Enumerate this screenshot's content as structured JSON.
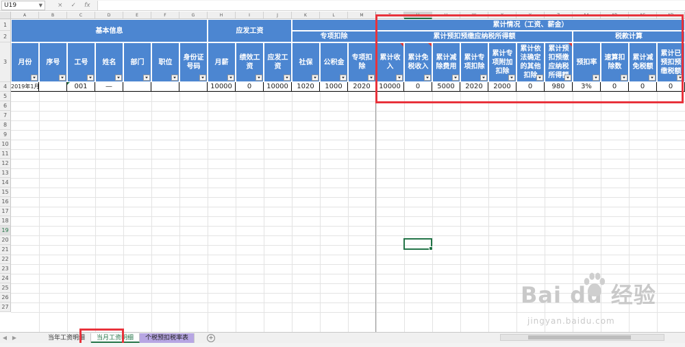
{
  "formula_bar": {
    "name_box": "U19",
    "cancel_icon": "×",
    "enter_icon": "✓",
    "fx_icon": "fx"
  },
  "columns": [
    "A",
    "B",
    "C",
    "D",
    "E",
    "F",
    "G",
    "H",
    "I",
    "J",
    "K",
    "L",
    "M",
    "T",
    "U",
    "V",
    "W",
    "X",
    "Y",
    "Z",
    "AA",
    "AB",
    "AC",
    "AD"
  ],
  "rows": [
    "1",
    "2",
    "3",
    "4",
    "5",
    "6",
    "7",
    "8",
    "9",
    "10",
    "11",
    "12",
    "13",
    "14",
    "15",
    "16",
    "17",
    "18",
    "19",
    "20",
    "21",
    "22",
    "23",
    "24",
    "25",
    "26",
    "27"
  ],
  "groups": {
    "basic_info": "基本信息",
    "gross_wage": "应发工资",
    "special_deduction": "专项扣除",
    "cumulative": "累计情况（工资、薪金）",
    "cumulative_taxable": "累计预扣预缴应纳税所得额",
    "tax_calc": "税款计算"
  },
  "headers": [
    "月份",
    "序号",
    "工号",
    "姓名",
    "部门",
    "职位",
    "身份证号码",
    "月薪",
    "绩效工资",
    "应发工资",
    "社保",
    "公积金",
    "专项扣除",
    "累计收入",
    "累计免税收入",
    "累计减除费用",
    "累计专项扣除",
    "累计专项附加扣除",
    "累计依法确定的其他扣除",
    "累计预扣预缴应纳税所得额",
    "预扣率",
    "速算扣除数",
    "累计减免税额",
    "累计已预扣预缴税额"
  ],
  "row4": [
    "2019年1月",
    "",
    "001",
    "—",
    "",
    "",
    "",
    "10000",
    "0",
    "10000",
    "1020",
    "1000",
    "2020",
    "10000",
    "0",
    "5000",
    "2020",
    "2000",
    "0",
    "980",
    "3%",
    "0",
    "0",
    "0"
  ],
  "sheet_tabs": [
    "当年工资明细",
    "当月工资明细",
    "个税预扣税率表"
  ],
  "active_tab": "当月工资明细",
  "watermark": {
    "brand": "Bai du 经验",
    "url": "jingyan.baidu.com"
  },
  "colors": {
    "header_blue": "#4c86d1",
    "highlight_red": "#e8323b",
    "excel_green": "#217346"
  }
}
